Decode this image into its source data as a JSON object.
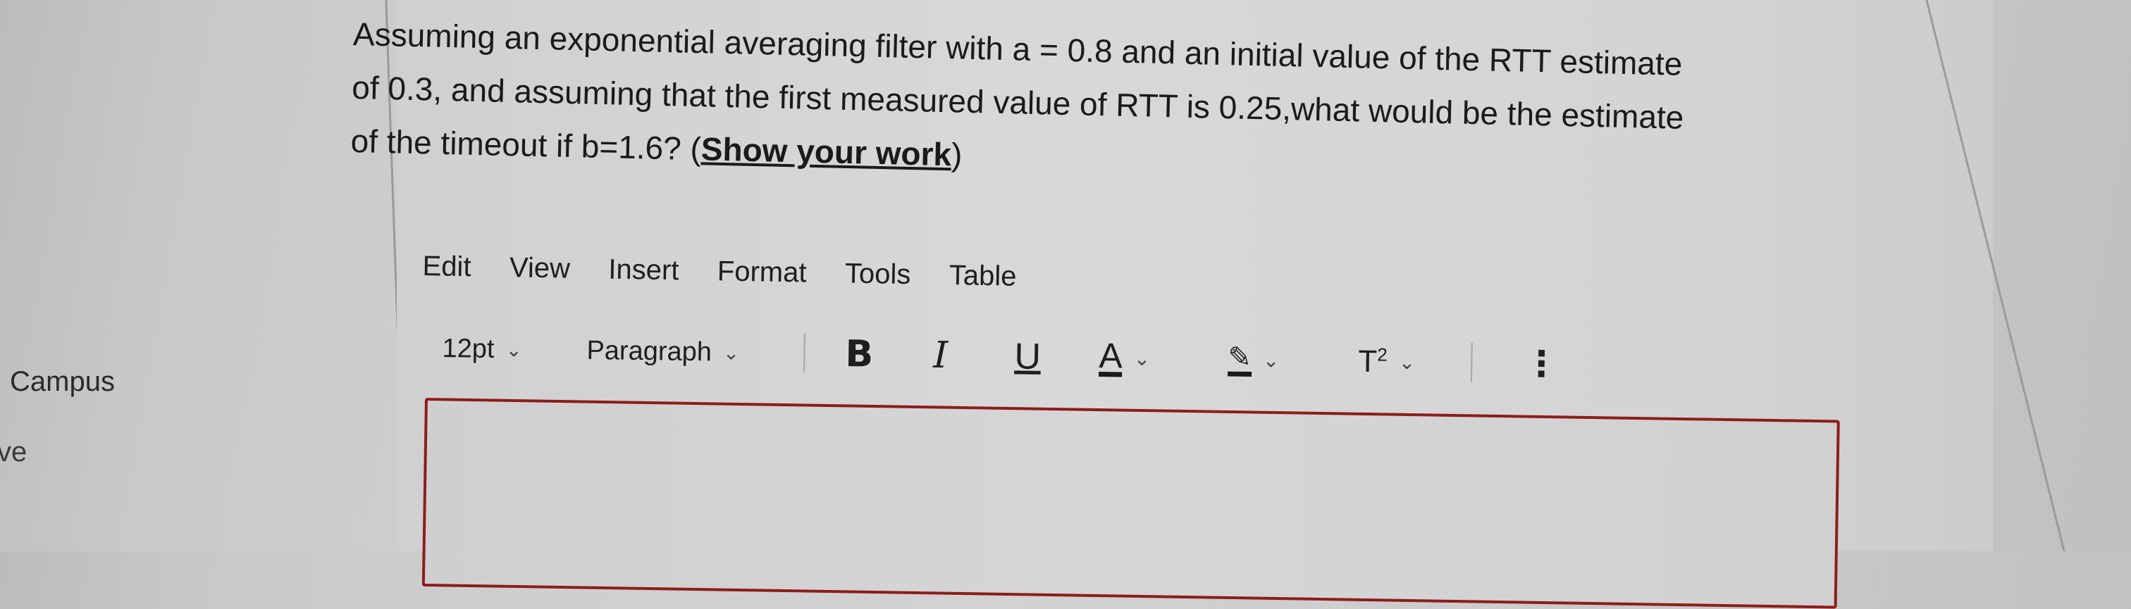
{
  "nav": {
    "campus": "Campus",
    "ve": "ve"
  },
  "question": {
    "line1": "Assuming an exponential averaging filter with a = 0.8 and an initial value of the RTT estimate",
    "line2": "of 0.3, and assuming that the first measured value of RTT is 0.25,what would be the estimate",
    "line3_prefix": "of the timeout  if b=1.6? (",
    "line3_emphasis": "Show your work",
    "line3_suffix": ")"
  },
  "menu": [
    "Edit",
    "View",
    "Insert",
    "Format",
    "Tools",
    "Table"
  ],
  "toolbar": {
    "font_size": "12pt",
    "block_format": "Paragraph",
    "bold": "B",
    "italic": "I",
    "underline": "U",
    "text_color": "A",
    "superscript_base": "T",
    "superscript_mark": "2",
    "more": "⋮",
    "chevron": "⌄",
    "highlight_icon": "✎"
  },
  "editor": {
    "value": "",
    "border_color": "#8d1c1c"
  }
}
